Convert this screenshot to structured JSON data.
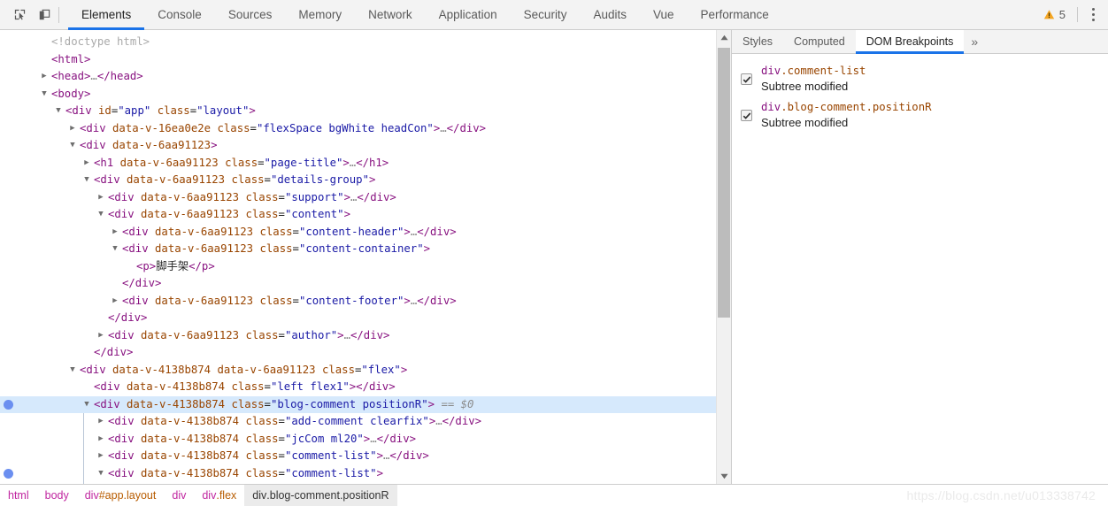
{
  "toolbar": {
    "inspect_icon": "inspect-element-icon",
    "device_icon": "device-toolbar-icon",
    "tabs": [
      {
        "label": "Elements",
        "active": true
      },
      {
        "label": "Console",
        "active": false
      },
      {
        "label": "Sources",
        "active": false
      },
      {
        "label": "Memory",
        "active": false
      },
      {
        "label": "Network",
        "active": false
      },
      {
        "label": "Application",
        "active": false
      },
      {
        "label": "Security",
        "active": false
      },
      {
        "label": "Audits",
        "active": false
      },
      {
        "label": "Vue",
        "active": false
      },
      {
        "label": "Performance",
        "active": false
      }
    ],
    "warning_count": "5",
    "accent_color": "#1a73e8",
    "warning_color": "#f5a623"
  },
  "tree": {
    "nodes": [
      {
        "indent": 0,
        "twisty": "",
        "html": "<span class=\"cm\">&lt;!doctype html&gt;</span>"
      },
      {
        "indent": 0,
        "twisty": "",
        "html": "<span class=\"pk\">&lt;html&gt;</span>"
      },
      {
        "indent": 0,
        "twisty": "▶",
        "html": "<span class=\"pk\">&lt;head&gt;</span><span class=\"el\">…</span><span class=\"pk\">&lt;/head&gt;</span>"
      },
      {
        "indent": 0,
        "twisty": "▼",
        "html": "<span class=\"pk\">&lt;body&gt;</span>"
      },
      {
        "indent": 1,
        "twisty": "▼",
        "html": "<span class=\"pk\">&lt;div</span> <span class=\"an\">id</span>=<span class=\"av\">\"app\"</span> <span class=\"an\">class</span>=<span class=\"av\">\"layout\"</span><span class=\"pk\">&gt;</span>"
      },
      {
        "indent": 2,
        "twisty": "▶",
        "html": "<span class=\"pk\">&lt;div</span> <span class=\"an\">data-v-16ea0e2e</span> <span class=\"an\">class</span>=<span class=\"av\">\"flexSpace bgWhite headCon\"</span><span class=\"pk\">&gt;</span><span class=\"el\">…</span><span class=\"pk\">&lt;/div&gt;</span>"
      },
      {
        "indent": 2,
        "twisty": "▼",
        "html": "<span class=\"pk\">&lt;div</span> <span class=\"an\">data-v-6aa91123</span><span class=\"pk\">&gt;</span>"
      },
      {
        "indent": 3,
        "twisty": "▶",
        "html": "<span class=\"pk\">&lt;h1</span> <span class=\"an\">data-v-6aa91123</span> <span class=\"an\">class</span>=<span class=\"av\">\"page-title\"</span><span class=\"pk\">&gt;</span><span class=\"el\">…</span><span class=\"pk\">&lt;/h1&gt;</span>"
      },
      {
        "indent": 3,
        "twisty": "▼",
        "html": "<span class=\"pk\">&lt;div</span> <span class=\"an\">data-v-6aa91123</span> <span class=\"an\">class</span>=<span class=\"av\">\"details-group\"</span><span class=\"pk\">&gt;</span>"
      },
      {
        "indent": 4,
        "twisty": "▶",
        "html": "<span class=\"pk\">&lt;div</span> <span class=\"an\">data-v-6aa91123</span> <span class=\"an\">class</span>=<span class=\"av\">\"support\"</span><span class=\"pk\">&gt;</span><span class=\"el\">…</span><span class=\"pk\">&lt;/div&gt;</span>"
      },
      {
        "indent": 4,
        "twisty": "▼",
        "html": "<span class=\"pk\">&lt;div</span> <span class=\"an\">data-v-6aa91123</span> <span class=\"an\">class</span>=<span class=\"av\">\"content\"</span><span class=\"pk\">&gt;</span>"
      },
      {
        "indent": 5,
        "twisty": "▶",
        "html": "<span class=\"pk\">&lt;div</span> <span class=\"an\">data-v-6aa91123</span> <span class=\"an\">class</span>=<span class=\"av\">\"content-header\"</span><span class=\"pk\">&gt;</span><span class=\"el\">…</span><span class=\"pk\">&lt;/div&gt;</span>"
      },
      {
        "indent": 5,
        "twisty": "▼",
        "html": "<span class=\"pk\">&lt;div</span> <span class=\"an\">data-v-6aa91123</span> <span class=\"an\">class</span>=<span class=\"av\">\"content-container\"</span><span class=\"pk\">&gt;</span>"
      },
      {
        "indent": 6,
        "twisty": "",
        "html": "<span class=\"pk\">&lt;p&gt;</span><span class=\"txt\">脚手架</span><span class=\"pk\">&lt;/p&gt;</span>"
      },
      {
        "indent": 5,
        "twisty": "",
        "html": "<span class=\"pk\">&lt;/div&gt;</span>"
      },
      {
        "indent": 5,
        "twisty": "▶",
        "html": "<span class=\"pk\">&lt;div</span> <span class=\"an\">data-v-6aa91123</span> <span class=\"an\">class</span>=<span class=\"av\">\"content-footer\"</span><span class=\"pk\">&gt;</span><span class=\"el\">…</span><span class=\"pk\">&lt;/div&gt;</span>"
      },
      {
        "indent": 4,
        "twisty": "",
        "html": "<span class=\"pk\">&lt;/div&gt;</span>"
      },
      {
        "indent": 4,
        "twisty": "▶",
        "html": "<span class=\"pk\">&lt;div</span> <span class=\"an\">data-v-6aa91123</span> <span class=\"an\">class</span>=<span class=\"av\">\"author\"</span><span class=\"pk\">&gt;</span><span class=\"el\">…</span><span class=\"pk\">&lt;/div&gt;</span>"
      },
      {
        "indent": 3,
        "twisty": "",
        "html": "<span class=\"pk\">&lt;/div&gt;</span>"
      },
      {
        "indent": 2,
        "twisty": "▼",
        "html": "<span class=\"pk\">&lt;div</span> <span class=\"an\">data-v-4138b874</span> <span class=\"an\">data-v-6aa91123</span> <span class=\"an\">class</span>=<span class=\"av\">\"flex\"</span><span class=\"pk\">&gt;</span>"
      },
      {
        "indent": 3,
        "twisty": "",
        "html": "<span class=\"pk\">&lt;div</span> <span class=\"an\">data-v-4138b874</span> <span class=\"an\">class</span>=<span class=\"av\">\"left flex1\"</span><span class=\"pk\">&gt;&lt;/div&gt;</span>"
      },
      {
        "indent": 3,
        "twisty": "▼",
        "selected": true,
        "dot": true,
        "html": "<span class=\"pk\">&lt;div</span> <span class=\"an\">data-v-4138b874</span> <span class=\"an\">class</span>=<span class=\"av\">\"blog-comment positionR\"</span><span class=\"pk\">&gt;</span> <span class=\"sel-ref\">== $0</span>"
      },
      {
        "indent": 4,
        "twisty": "▶",
        "html": "<span class=\"pk\">&lt;div</span> <span class=\"an\">data-v-4138b874</span> <span class=\"an\">class</span>=<span class=\"av\">\"add-comment clearfix\"</span><span class=\"pk\">&gt;</span><span class=\"el\">…</span><span class=\"pk\">&lt;/div&gt;</span>"
      },
      {
        "indent": 4,
        "twisty": "▶",
        "html": "<span class=\"pk\">&lt;div</span> <span class=\"an\">data-v-4138b874</span> <span class=\"an\">class</span>=<span class=\"av\">\"jcCom ml20\"</span><span class=\"pk\">&gt;</span><span class=\"el\">…</span><span class=\"pk\">&lt;/div&gt;</span>"
      },
      {
        "indent": 4,
        "twisty": "▶",
        "html": "<span class=\"pk\">&lt;div</span> <span class=\"an\">data-v-4138b874</span> <span class=\"an\">class</span>=<span class=\"av\">\"comment-list\"</span><span class=\"pk\">&gt;</span><span class=\"el\">…</span><span class=\"pk\">&lt;/div&gt;</span>"
      },
      {
        "indent": 4,
        "twisty": "▼",
        "dot": true,
        "html": "<span class=\"pk\">&lt;div</span> <span class=\"an\">data-v-4138b874</span> <span class=\"an\">class</span>=<span class=\"av\">\"comment-list\"</span><span class=\"pk\">&gt;</span>"
      }
    ]
  },
  "sidebar": {
    "tabs": [
      {
        "label": "Styles",
        "active": false
      },
      {
        "label": "Computed",
        "active": false
      },
      {
        "label": "DOM Breakpoints",
        "active": true
      }
    ],
    "more_glyph": "»",
    "breakpoints": [
      {
        "tag": "div",
        "classes": ".comment-list",
        "description": "Subtree modified",
        "checked": true
      },
      {
        "tag": "div",
        "classes": ".blog-comment.positionR",
        "description": "Subtree modified",
        "checked": true
      }
    ]
  },
  "breadcrumb": [
    {
      "tag": "html",
      "id": "",
      "classes": "",
      "active": false
    },
    {
      "tag": "body",
      "id": "",
      "classes": "",
      "active": false
    },
    {
      "tag": "div",
      "id": "#app",
      "classes": ".layout",
      "active": false
    },
    {
      "tag": "div",
      "id": "",
      "classes": "",
      "active": false
    },
    {
      "tag": "div",
      "id": "",
      "classes": ".flex",
      "active": false
    },
    {
      "tag": "div",
      "id": "",
      "classes": ".blog-comment.positionR",
      "active": true
    }
  ],
  "watermark": "https://blog.csdn.net/u013338742"
}
